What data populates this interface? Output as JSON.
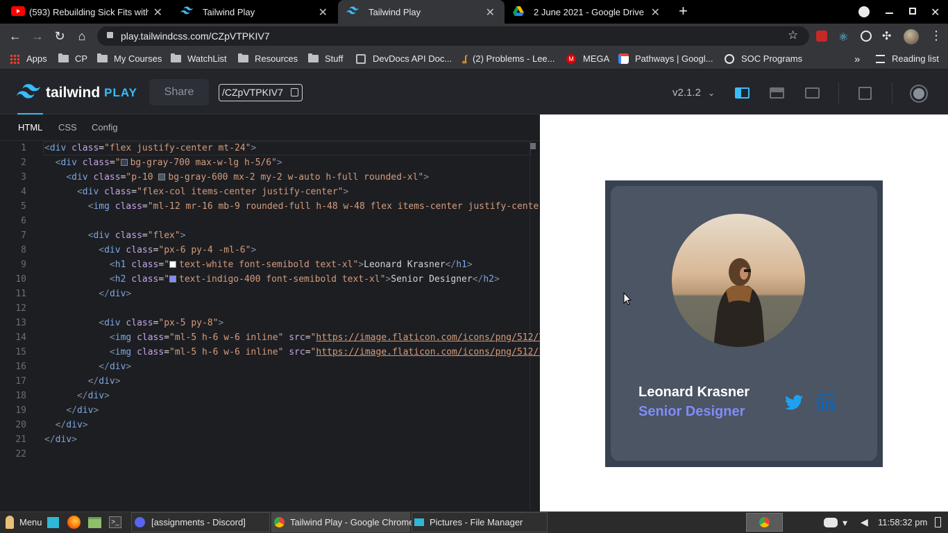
{
  "browser": {
    "tabs": [
      {
        "title": "(593) Rebuilding Sick Fits with",
        "icon": "youtube-icon",
        "active": false
      },
      {
        "title": "Tailwind Play",
        "icon": "tailwind-icon",
        "active": false
      },
      {
        "title": "Tailwind Play",
        "icon": "tailwind-icon",
        "active": true
      },
      {
        "title": "2 June 2021 - Google Drive",
        "icon": "google-drive-icon",
        "active": false
      }
    ],
    "url": "play.tailwindcss.com/CZpVTPKIV7",
    "bookmarks": [
      {
        "label": "Apps",
        "icon": "apps-grid-icon"
      },
      {
        "label": "CP",
        "icon": "folder-icon"
      },
      {
        "label": "My Courses",
        "icon": "folder-icon"
      },
      {
        "label": "WatchList",
        "icon": "folder-icon"
      },
      {
        "label": "Resources",
        "icon": "folder-icon"
      },
      {
        "label": "Stuff",
        "icon": "folder-icon"
      },
      {
        "label": "DevDocs API Doc...",
        "icon": "devdocs-icon"
      },
      {
        "label": "(2) Problems - Lee...",
        "icon": "leetcode-icon"
      },
      {
        "label": "MEGA",
        "icon": "mega-icon"
      },
      {
        "label": "Pathways | Googl...",
        "icon": "google-icon"
      },
      {
        "label": "SOC Programs",
        "icon": "globe-icon"
      }
    ],
    "reading_list": "Reading list"
  },
  "app": {
    "logo_text": "tailwind",
    "logo_suffix": "PLAY",
    "share_label": "Share",
    "playground_id": "/CZpVTPKIV7",
    "version": "v2.1.2"
  },
  "editor": {
    "tabs": [
      "HTML",
      "CSS",
      "Config"
    ],
    "active_tab": "HTML"
  },
  "preview": {
    "name": "Leonard Krasner",
    "role": "Senior Designer",
    "colors": {
      "outer": "#374151",
      "inner": "#4b5563",
      "role": "#818cf8",
      "twitter": "#1da1f2",
      "linkedin": "#0a66c2"
    }
  },
  "taskbar": {
    "menu": "Menu",
    "windows": [
      {
        "label": "[assignments - Discord]",
        "icon": "discord-icon"
      },
      {
        "label": "Tailwind Play - Google Chrome",
        "icon": "chrome-icon"
      },
      {
        "label": "Pictures - File Manager",
        "icon": "folder-icon"
      }
    ],
    "clock": "11:58:32 pm"
  }
}
